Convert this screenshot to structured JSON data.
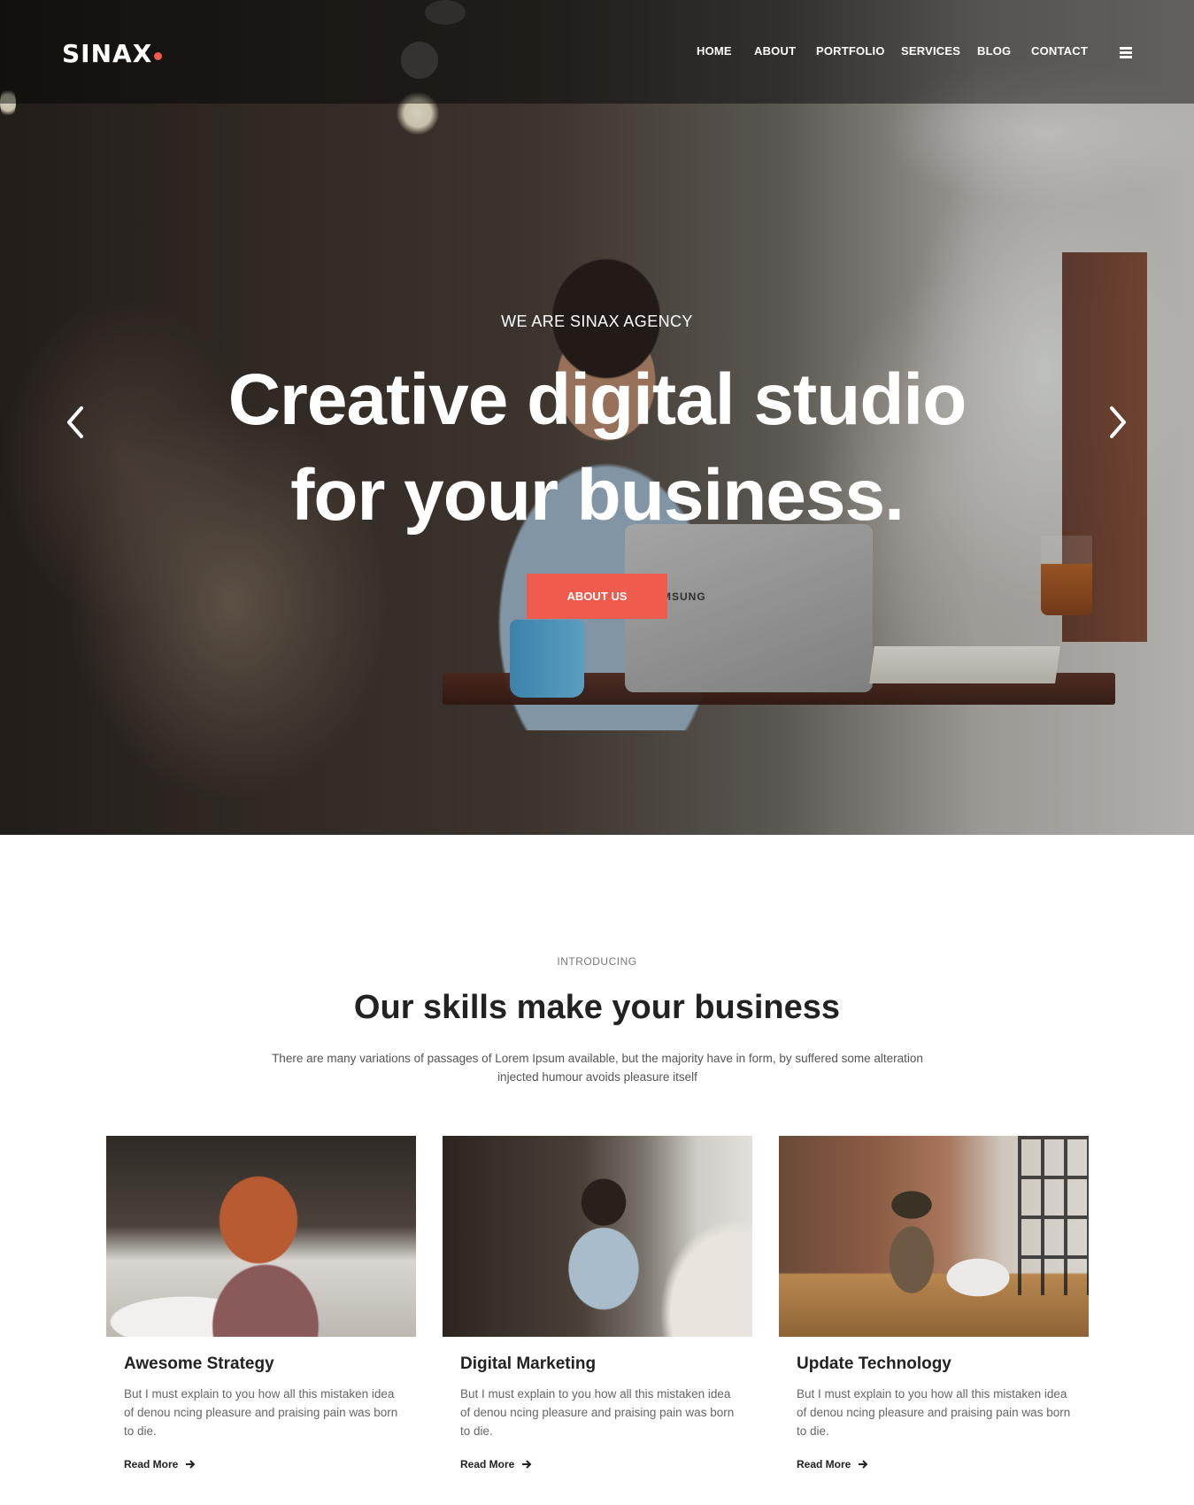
{
  "brand": {
    "name": "SINAX",
    "accent": "#ef5b4c"
  },
  "nav": {
    "items": [
      {
        "label": "HOME"
      },
      {
        "label": "ABOUT"
      },
      {
        "label": "PORTFOLIO"
      },
      {
        "label": "SERVICES"
      },
      {
        "label": "BLOG"
      },
      {
        "label": "CONTACT"
      }
    ],
    "menu_icon": "hamburger-menu-icon"
  },
  "hero": {
    "eyebrow": "WE ARE SINAX AGENCY",
    "title_line1": "Creative digital studio",
    "title_line2": "for your business.",
    "button_label": "ABOUT US",
    "laptop_brand": "MSUNG",
    "prev_icon": "chevron-left-icon",
    "next_icon": "chevron-right-icon"
  },
  "intro": {
    "eyebrow": "INTRODUCING",
    "title": "Our skills make your business",
    "text": "There are many variations of passages of Lorem Ipsum available, but the majority have in form, by suffered some alteration injected humour avoids pleasure itself"
  },
  "cards": [
    {
      "title": "Awesome Strategy",
      "text": "But I must explain to you how all this mistaken idea of denou ncing pleasure and praising pain was born to die.",
      "link": "Read More"
    },
    {
      "title": "Digital Marketing",
      "text": "But I must explain to you how all this mistaken idea of denou ncing pleasure and praising pain was born to die.",
      "link": "Read More"
    },
    {
      "title": "Update Technology",
      "text": "But I must explain to you how all this mistaken idea of denou ncing pleasure and praising pain was born to die.",
      "link": "Read More"
    }
  ]
}
